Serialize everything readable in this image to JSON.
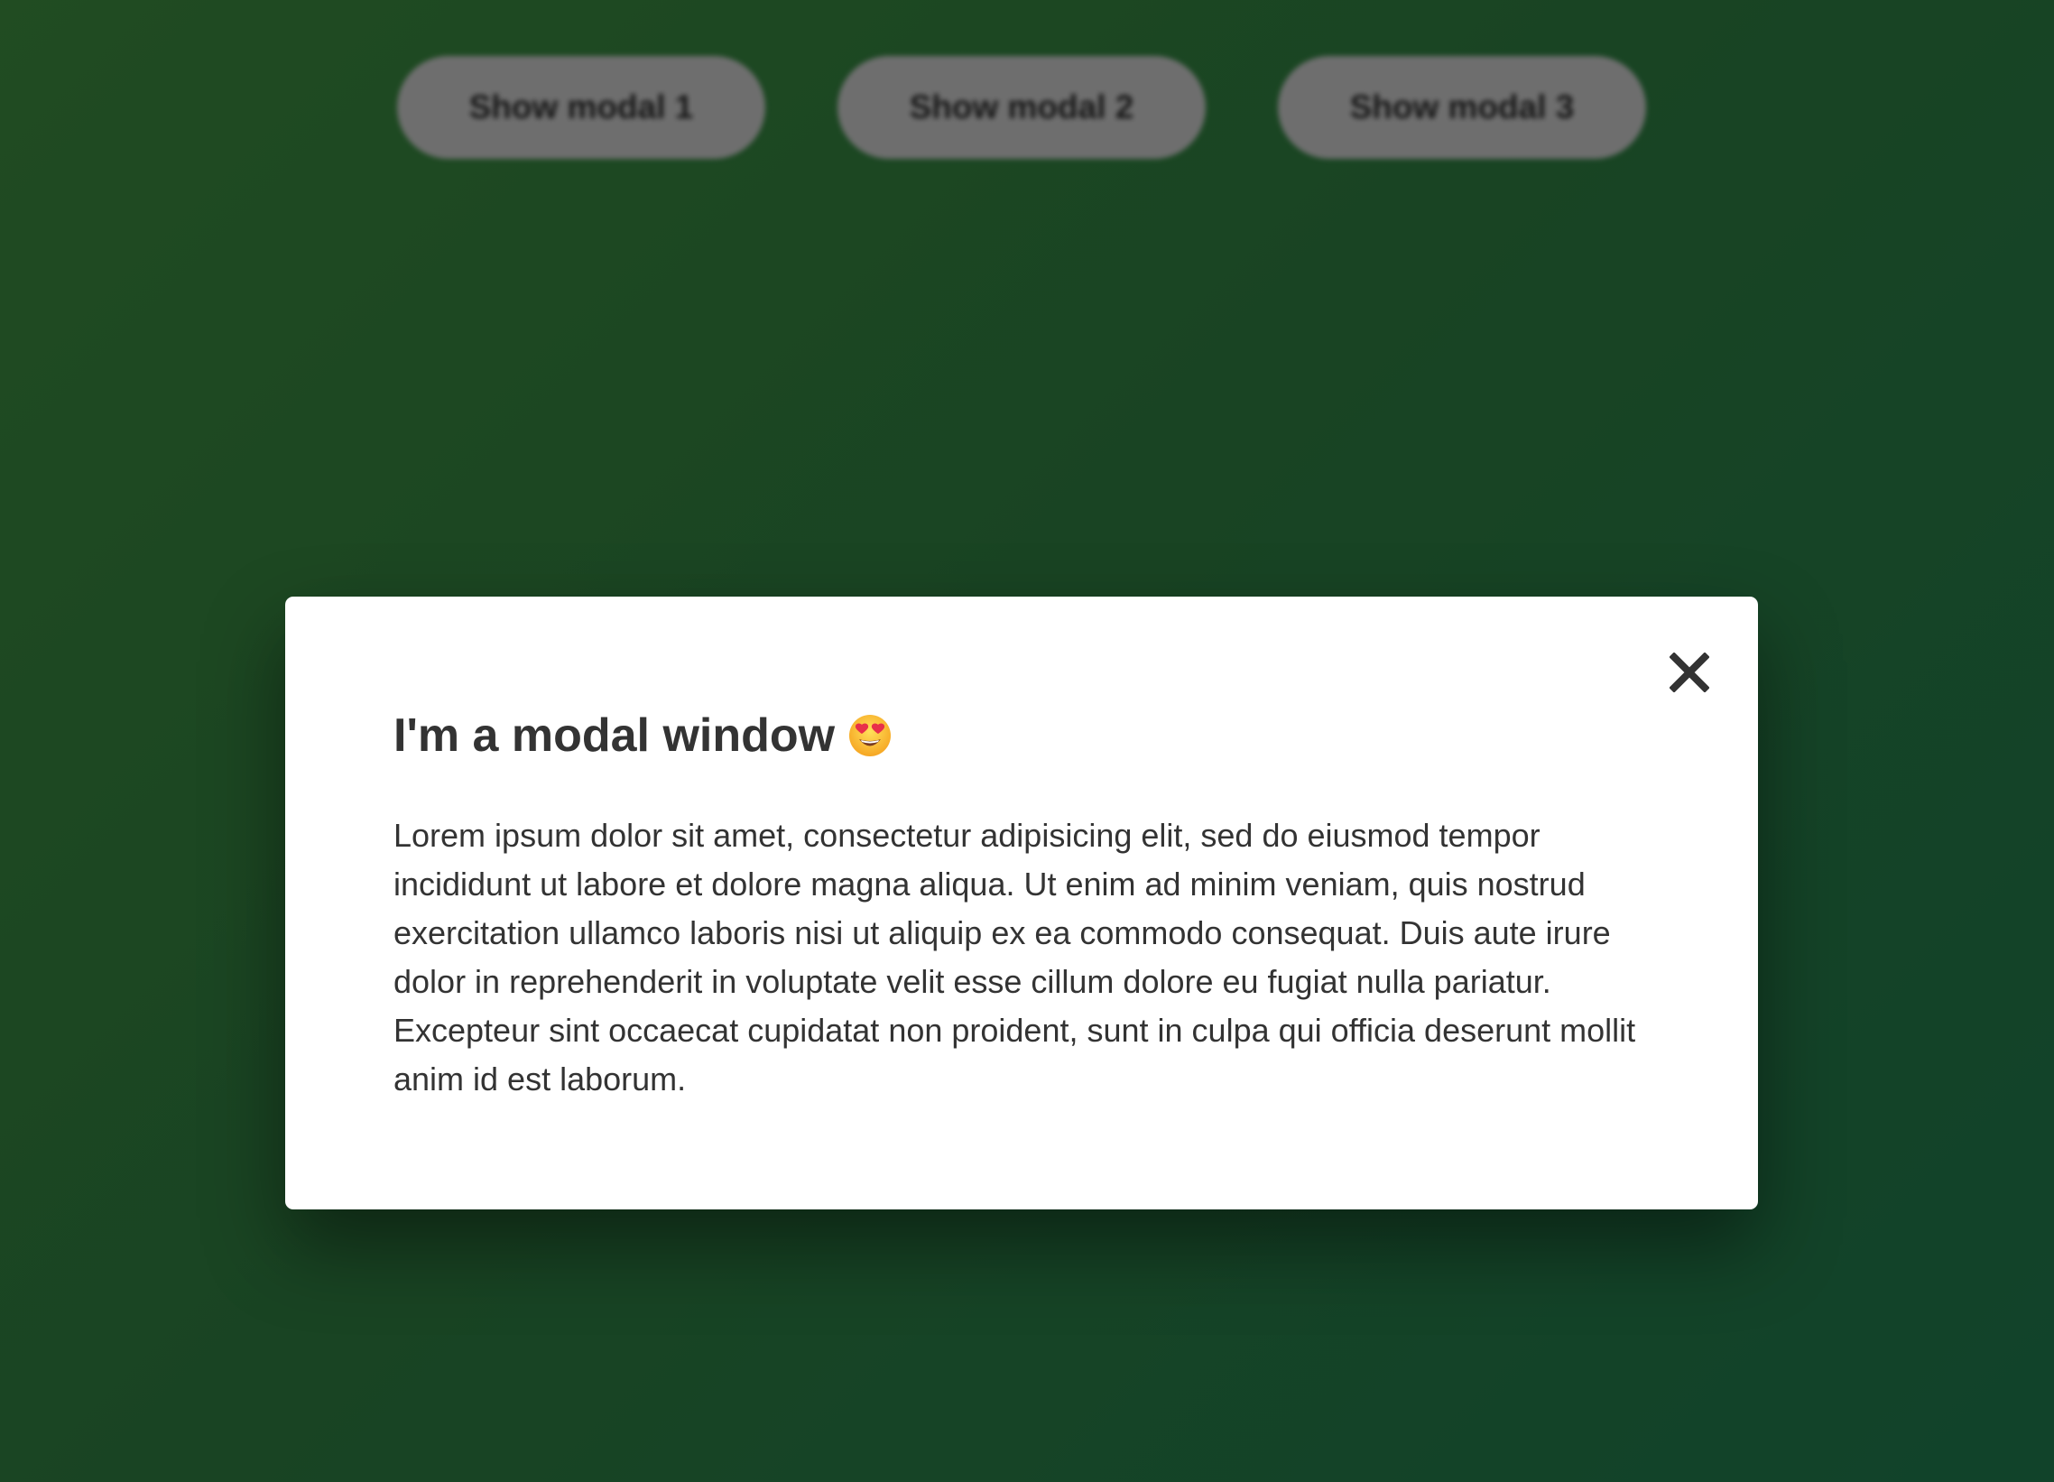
{
  "background": {
    "buttons": [
      {
        "label": "Show modal 1"
      },
      {
        "label": "Show modal 2"
      },
      {
        "label": "Show modal 3"
      }
    ],
    "gradient_colors": [
      "#3c8a3e",
      "#1f7a4e"
    ]
  },
  "modal": {
    "title": "I'm a modal window",
    "title_emoji": "smiling-face-with-heart-eyes-icon",
    "body": "Lorem ipsum dolor sit amet, consectetur adipisicing elit, sed do eiusmod tempor incididunt ut labore et dolore magna aliqua. Ut enim ad minim veniam, quis nostrud exercitation ullamco laboris nisi ut aliquip ex ea commodo consequat. Duis aute irure dolor in reprehenderit in voluptate velit esse cillum dolore eu fugiat nulla pariatur. Excepteur sint occaecat cupidatat non proident, sunt in culpa qui officia deserunt mollit anim id est laborum.",
    "close_icon": "close-icon"
  }
}
